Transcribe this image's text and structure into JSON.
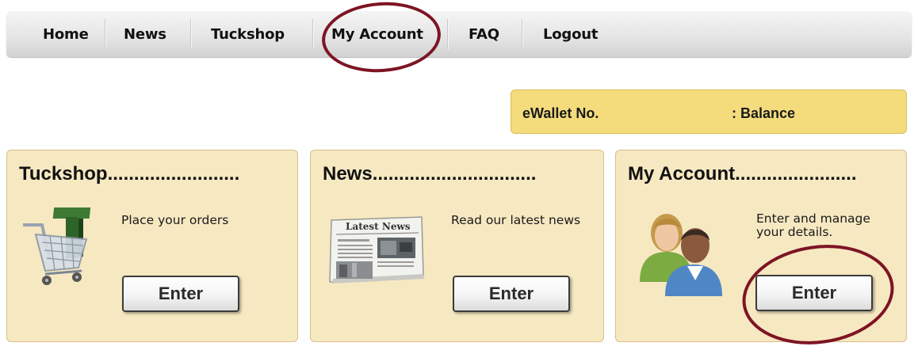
{
  "nav": {
    "items": [
      {
        "label": "Home"
      },
      {
        "label": "News"
      },
      {
        "label": "Tuckshop"
      },
      {
        "label": "My Account"
      },
      {
        "label": "FAQ"
      },
      {
        "label": "Logout"
      }
    ]
  },
  "ewallet": {
    "number_label": "eWallet No.",
    "balance_label": ": Balance"
  },
  "cards": {
    "tuckshop": {
      "title": "Tuckshop.........................",
      "description": "Place your orders",
      "button_label": "Enter",
      "icon": "shopping-cart-icon"
    },
    "news": {
      "title": "News...............................",
      "description": "Read our latest news",
      "button_label": "Enter",
      "icon": "newspaper-icon",
      "image_text": "Latest News"
    },
    "account": {
      "title": "My Account.......................",
      "description_line1": "Enter and manage",
      "description_line2": "your details.",
      "button_label": "Enter",
      "icon": "users-icon"
    }
  },
  "colors": {
    "card_bg": "#f6e8c1",
    "ewallet_bg": "#f4dc7d",
    "annotation_ring": "#7d1424"
  }
}
